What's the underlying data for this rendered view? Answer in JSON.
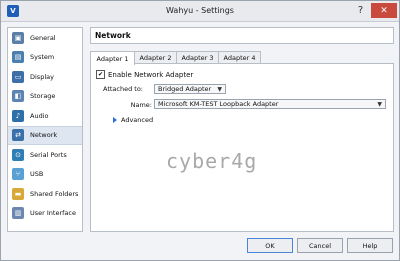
{
  "window": {
    "title": "Wahyu - Settings",
    "help_label": "?",
    "close_label": "✕"
  },
  "sidebar": {
    "items": [
      {
        "label": "General",
        "icon": "general-icon",
        "color": "#5b7fa6"
      },
      {
        "label": "System",
        "icon": "system-icon",
        "color": "#4a7fb0"
      },
      {
        "label": "Display",
        "icon": "display-icon",
        "color": "#3d6fa8"
      },
      {
        "label": "Storage",
        "icon": "storage-icon",
        "color": "#5d84b3"
      },
      {
        "label": "Audio",
        "icon": "audio-icon",
        "color": "#2e6fa8"
      },
      {
        "label": "Network",
        "icon": "network-icon",
        "color": "#3a70aa",
        "selected": true
      },
      {
        "label": "Serial Ports",
        "icon": "serial-ports-icon",
        "color": "#2f7fb6"
      },
      {
        "label": "USB",
        "icon": "usb-icon",
        "color": "#5aa0d2"
      },
      {
        "label": "Shared Folders",
        "icon": "shared-folders-icon",
        "color": "#d9a83a"
      },
      {
        "label": "User Interface",
        "icon": "user-interface-icon",
        "color": "#6c87b0"
      }
    ]
  },
  "panel": {
    "title": "Network"
  },
  "tabs": [
    {
      "label": "Adapter 1",
      "active": true
    },
    {
      "label": "Adapter 2"
    },
    {
      "label": "Adapter 3"
    },
    {
      "label": "Adapter 4"
    }
  ],
  "adapter": {
    "enable_label": "Enable Network Adapter",
    "enabled": true,
    "attached_label": "Attached to:",
    "attached_value": "Bridged Adapter",
    "name_label": "Name:",
    "name_value": "Microsoft KM-TEST Loopback Adapter",
    "advanced_label": "Advanced"
  },
  "watermark": "cyber4g",
  "footer": {
    "ok_label": "OK",
    "cancel_label": "Cancel",
    "help_label": "Help"
  }
}
